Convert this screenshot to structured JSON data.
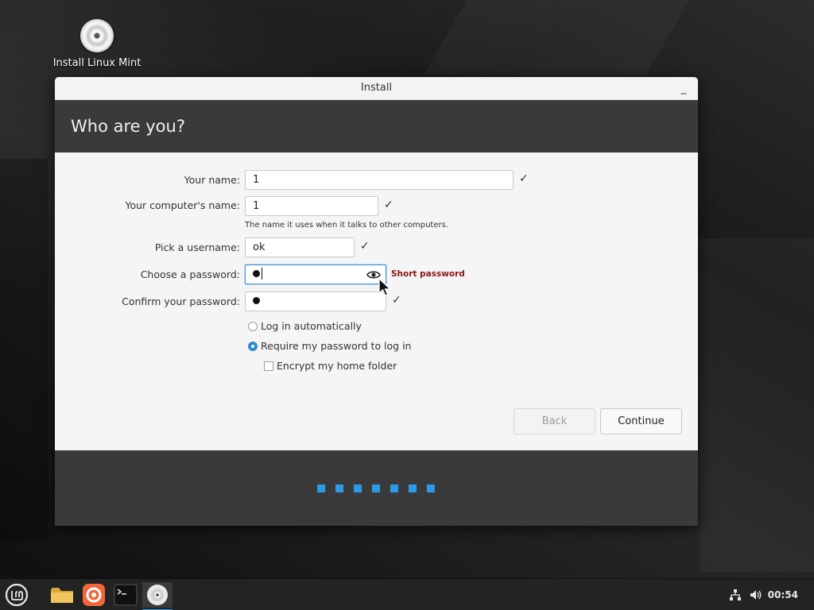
{
  "desktop": {
    "icon_label": "Install Linux Mint"
  },
  "window": {
    "title": "Install",
    "minimize_label": "_",
    "header": "Who are you?"
  },
  "form": {
    "name_label": "Your name:",
    "name_value": "1",
    "computer_label": "Your computer's name:",
    "computer_value": "1",
    "computer_hint": "The name it uses when it talks to other computers.",
    "username_label": "Pick a username:",
    "username_value": "ok",
    "password_label": "Choose a password:",
    "password_strength": "Short password",
    "confirm_label": "Confirm your password:",
    "login_auto": "Log in automatically",
    "login_require": "Require my password to log in",
    "encrypt_home": "Encrypt my home folder",
    "check_glyph": "✓"
  },
  "buttons": {
    "back": "Back",
    "continue": "Continue"
  },
  "progress": {
    "steps": 7
  },
  "taskbar": {
    "clock": "00:54"
  },
  "colors": {
    "accent": "#2b9ae8",
    "warning": "#8a1616",
    "header_bg": "#3a3a3a"
  },
  "icons": [
    "mint-menu-icon",
    "folder-icon",
    "firefox-icon",
    "terminal-icon",
    "installer-disc-icon",
    "network-icon",
    "volume-icon",
    "eye-icon"
  ]
}
